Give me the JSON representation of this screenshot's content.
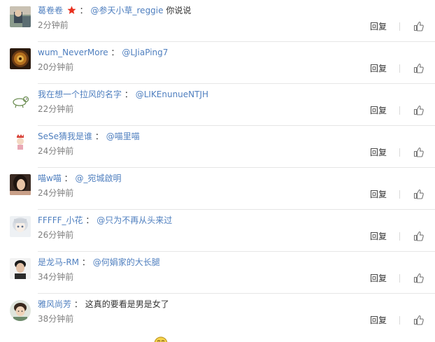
{
  "comments": [
    {
      "user": "葛卷卷",
      "has_badge": true,
      "colon": "：",
      "mention": "@参天小草_reggie",
      "text": " 你说说",
      "time": "2分钟前"
    },
    {
      "user": "wum_NeverMore",
      "has_badge": false,
      "colon": "：",
      "mention": "@LJiaPing7",
      "text": "",
      "time": "20分钟前"
    },
    {
      "user": "我在想一个拉风的名字",
      "has_badge": false,
      "colon": "：",
      "mention": "@LIKEnunueNTJH",
      "text": "",
      "time": "22分钟前"
    },
    {
      "user": "SeSe猜我是谁",
      "has_badge": false,
      "colon": "：",
      "mention": "@喵里喵",
      "text": "",
      "time": "24分钟前"
    },
    {
      "user": "喵w喵",
      "has_badge": false,
      "colon": "：",
      "mention": "@_宛城啟明",
      "text": "",
      "time": "24分钟前"
    },
    {
      "user": "FFFFF_小花",
      "has_badge": false,
      "colon": "：",
      "mention": "@只为不再从头来过",
      "text": "",
      "time": "26分钟前"
    },
    {
      "user": "是龙马-RM",
      "has_badge": false,
      "colon": "：",
      "mention": "@何娟家的大长腿",
      "text": "",
      "time": "34分钟前"
    },
    {
      "user": "雅风尚芳",
      "has_badge": false,
      "colon": "：",
      "mention": "",
      "text": "这真的要看是男是女了",
      "time": "38分钟前"
    }
  ],
  "actions": {
    "reply_label": "回复"
  },
  "icons": {
    "like": "thumbs-up-icon",
    "badge": "vip-star-icon",
    "partial": "emoji-icon"
  },
  "colors": {
    "link": "#4f7fbf",
    "text": "#333333",
    "time": "#808080",
    "divider": "#e6e6e6",
    "badge": "#e8301e"
  }
}
